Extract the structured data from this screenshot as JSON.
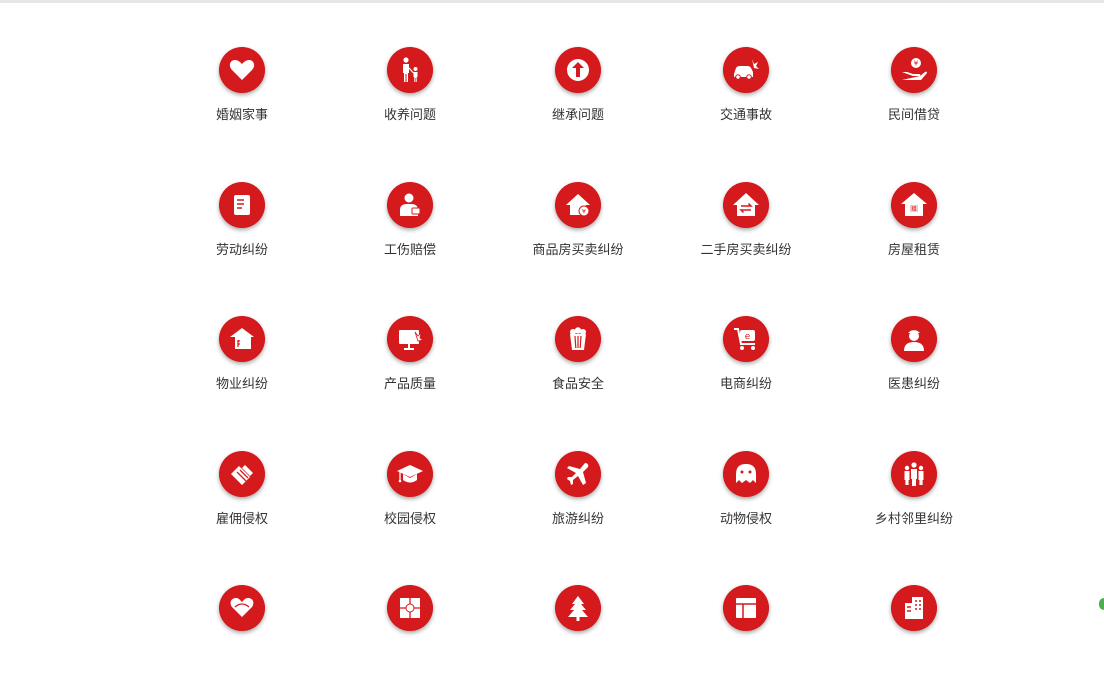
{
  "categories": [
    {
      "label": "婚姻家事",
      "icon": "heart-icon"
    },
    {
      "label": "收养问题",
      "icon": "parent-child-icon"
    },
    {
      "label": "继承问题",
      "icon": "arrow-up-icon"
    },
    {
      "label": "交通事故",
      "icon": "car-crash-icon"
    },
    {
      "label": "民间借贷",
      "icon": "hand-coin-icon"
    },
    {
      "label": "劳动纠纷",
      "icon": "document-icon"
    },
    {
      "label": "工伤赔偿",
      "icon": "injured-worker-icon"
    },
    {
      "label": "商品房买卖纠纷",
      "icon": "house-yuan-icon"
    },
    {
      "label": "二手房买卖纠纷",
      "icon": "house-exchange-icon"
    },
    {
      "label": "房屋租赁",
      "icon": "house-rent-icon"
    },
    {
      "label": "物业纠纷",
      "icon": "property-house-icon"
    },
    {
      "label": "产品质量",
      "icon": "monitor-icon"
    },
    {
      "label": "食品安全",
      "icon": "popcorn-icon"
    },
    {
      "label": "电商纠纷",
      "icon": "shopping-cart-e-icon"
    },
    {
      "label": "医患纠纷",
      "icon": "doctor-icon"
    },
    {
      "label": "雇佣侵权",
      "icon": "handshake-icon"
    },
    {
      "label": "校园侵权",
      "icon": "graduation-cap-icon"
    },
    {
      "label": "旅游纠纷",
      "icon": "airplane-icon"
    },
    {
      "label": "动物侵权",
      "icon": "animal-icon"
    },
    {
      "label": "乡村邻里纠纷",
      "icon": "people-group-icon"
    },
    {
      "label": "",
      "icon": "handshake-heart-icon"
    },
    {
      "label": "",
      "icon": "grid-sun-icon"
    },
    {
      "label": "",
      "icon": "tree-icon"
    },
    {
      "label": "",
      "icon": "window-icon"
    },
    {
      "label": "",
      "icon": "building-icon"
    }
  ],
  "colors": {
    "accent": "#d51a1d",
    "label_text": "#333333"
  }
}
